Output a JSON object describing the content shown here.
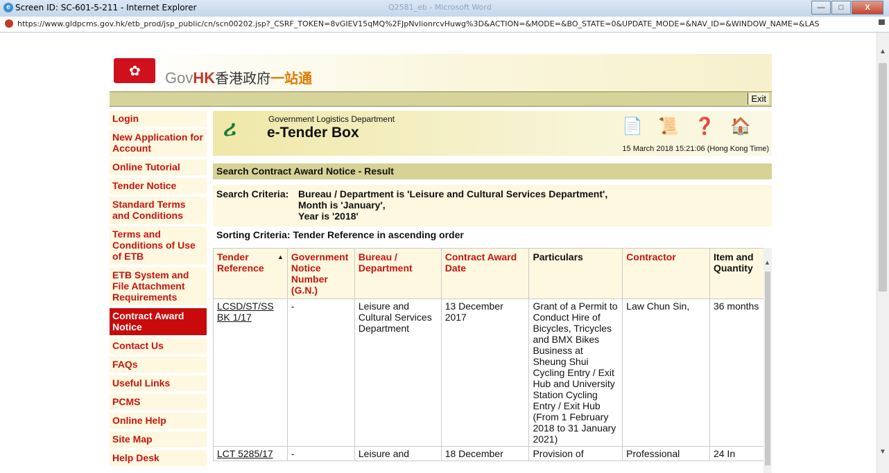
{
  "window": {
    "title": "Screen ID: SC-601-5-211 - Internet Explorer",
    "background_title": "Q2581_eb - Microsoft Word",
    "url": "https://www.gldpcms.gov.hk/etb_prod/jsp_public/cn/scn00202.jsp?_CSRF_TOKEN=8vGIEV15qMQ%2FJpNvIionrcvHuwg%3D&ACTION=&MODE=&BO_STATE=0&UPDATE_MODE=&NAV_ID=&WINDOW_NAME=&LAS",
    "minimize": "—",
    "maximize": "□",
    "close": "X"
  },
  "header": {
    "logo_gov": "Gov",
    "logo_hk": "HK",
    "logo_cn": "香港政府",
    "logo_cn2": "一站通",
    "exit_label": "Exit"
  },
  "menu": {
    "items": [
      {
        "label": "Login",
        "active": false
      },
      {
        "label": "New Application for Account",
        "active": false
      },
      {
        "label": "Online Tutorial",
        "active": false
      },
      {
        "label": "Tender Notice",
        "active": false
      },
      {
        "label": "Standard Terms and Conditions",
        "active": false
      },
      {
        "label": "Terms and Conditions of Use of ETB",
        "active": false
      },
      {
        "label": "ETB System and File Attachment Requirements",
        "active": false
      },
      {
        "label": "Contract Award Notice",
        "active": true
      },
      {
        "label": "Contact Us",
        "active": false
      },
      {
        "label": "FAQs",
        "active": false
      },
      {
        "label": "Useful Links",
        "active": false
      },
      {
        "label": "PCMS",
        "active": false
      },
      {
        "label": "Online Help",
        "active": false
      },
      {
        "label": "Site Map",
        "active": false
      },
      {
        "label": "Help Desk",
        "active": false
      }
    ]
  },
  "banner": {
    "department": "Government Logistics Department",
    "system": "e-Tender Box",
    "timestamp": "15 March 2018 15:21:06 (Hong Kong Time)",
    "icons": [
      "document-icon",
      "certificate-icon",
      "help-icon",
      "home-icon"
    ]
  },
  "result": {
    "heading": "Search Contract Award Notice - Result",
    "criteria_label": "Search Criteria:",
    "criteria_1": "Bureau / Department is 'Leisure and Cultural Services Department',",
    "criteria_2": "Month is 'January',",
    "criteria_3": "Year is '2018'",
    "sorting": "Sorting Criteria: Tender Reference in ascending order"
  },
  "table": {
    "headers": [
      "Tender Reference",
      "Government Notice Number (G.N.)",
      "Bureau / Department",
      "Contract Award Date",
      "Particulars",
      "Contractor",
      "Item and Quantity"
    ],
    "rows": [
      {
        "ref": "LCSD/ST/SS BK 1/17",
        "gn": "-",
        "dept": "Leisure and Cultural Services Department",
        "date": "13 December 2017",
        "particulars": "Grant of a Permit to Conduct Hire of Bicycles, Tricycles and BMX Bikes Business at Sheung Shui Cycling Entry / Exit Hub and University Station Cycling Entry / Exit Hub (From 1 February 2018 to 31 January 2021)",
        "contractor": "Law Chun Sin,",
        "qty": "36 months"
      },
      {
        "ref": "LCT 5285/17",
        "gn": "-",
        "dept": "Leisure and",
        "date": "18 December",
        "particulars": "Provision of",
        "contractor": "Professional",
        "qty": "24 In"
      }
    ]
  }
}
